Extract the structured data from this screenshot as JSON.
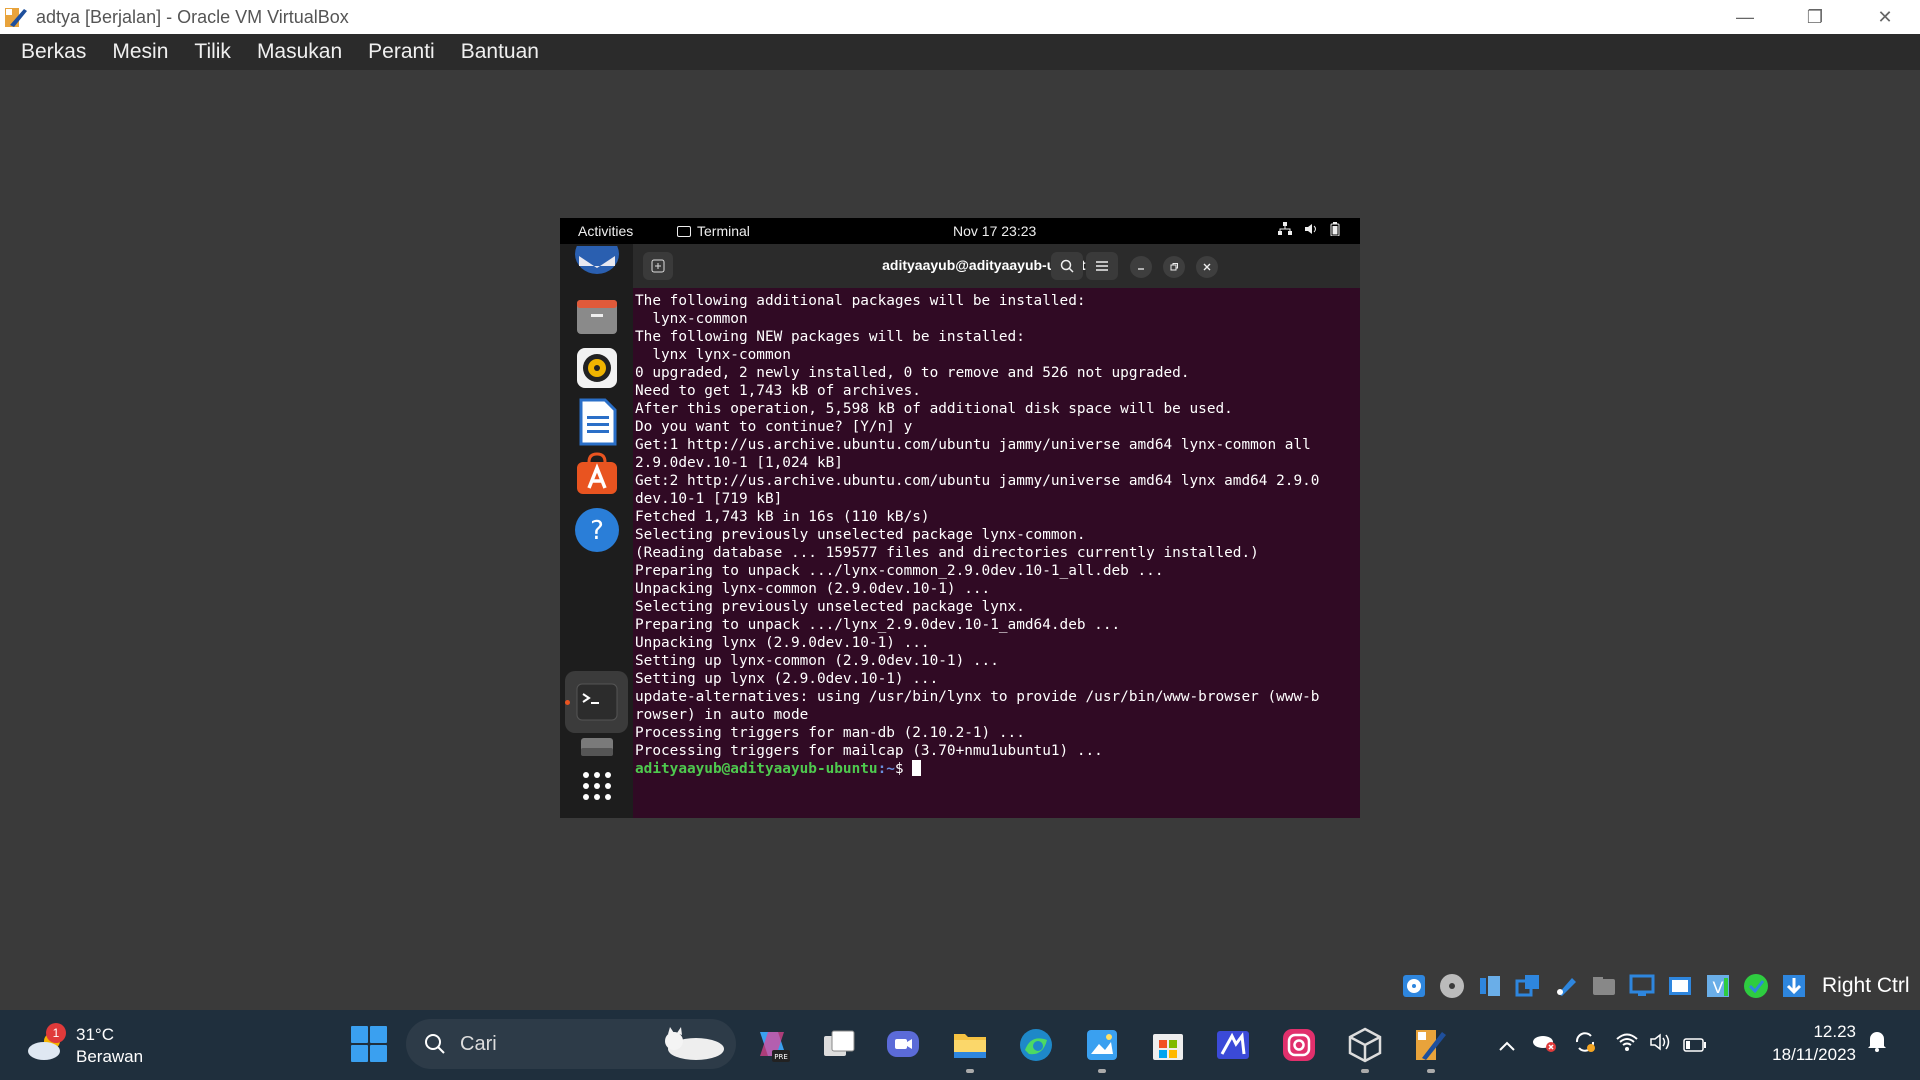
{
  "window": {
    "title": "adtya [Berjalan] - Oracle VM VirtualBox",
    "controls": {
      "minimize": "—",
      "restore": "❐",
      "close": "✕"
    }
  },
  "vbox_menu": [
    "Berkas",
    "Mesin",
    "Tilik",
    "Masukan",
    "Peranti",
    "Bantuan"
  ],
  "gnome": {
    "activities": "Activities",
    "app_name": "Terminal",
    "clock": "Nov 17  23:23"
  },
  "terminal": {
    "title": "adityaayub@adityaayub-ubuntu: ~",
    "lines": [
      "The following additional packages will be installed:",
      "  lynx-common",
      "The following NEW packages will be installed:",
      "  lynx lynx-common",
      "0 upgraded, 2 newly installed, 0 to remove and 526 not upgraded.",
      "Need to get 1,743 kB of archives.",
      "After this operation, 5,598 kB of additional disk space will be used.",
      "Do you want to continue? [Y/n] y",
      "Get:1 http://us.archive.ubuntu.com/ubuntu jammy/universe amd64 lynx-common all",
      "2.9.0dev.10-1 [1,024 kB]",
      "Get:2 http://us.archive.ubuntu.com/ubuntu jammy/universe amd64 lynx amd64 2.9.0",
      "dev.10-1 [719 kB]",
      "Fetched 1,743 kB in 16s (110 kB/s)",
      "Selecting previously unselected package lynx-common.",
      "(Reading database ... 159577 files and directories currently installed.)",
      "Preparing to unpack .../lynx-common_2.9.0dev.10-1_all.deb ...",
      "Unpacking lynx-common (2.9.0dev.10-1) ...",
      "Selecting previously unselected package lynx.",
      "Preparing to unpack .../lynx_2.9.0dev.10-1_amd64.deb ...",
      "Unpacking lynx (2.9.0dev.10-1) ...",
      "Setting up lynx-common (2.9.0dev.10-1) ...",
      "Setting up lynx (2.9.0dev.10-1) ...",
      "update-alternatives: using /usr/bin/lynx to provide /usr/bin/www-browser (www-b",
      "rowser) in auto mode",
      "Processing triggers for man-db (2.10.2-1) ...",
      "Processing triggers for mailcap (3.70+nmu1ubuntu1) ..."
    ],
    "prompt_user": "adityaayub@adityaayub-ubuntu",
    "prompt_path": ":~",
    "prompt_symbol": "$ "
  },
  "vbox_status": {
    "host_key": "Right Ctrl"
  },
  "taskbar": {
    "weather_temp": "31°C",
    "weather_desc": "Berawan",
    "weather_badge": "1",
    "search_label": "Cari",
    "time": "12.23",
    "date": "18/11/2023"
  }
}
